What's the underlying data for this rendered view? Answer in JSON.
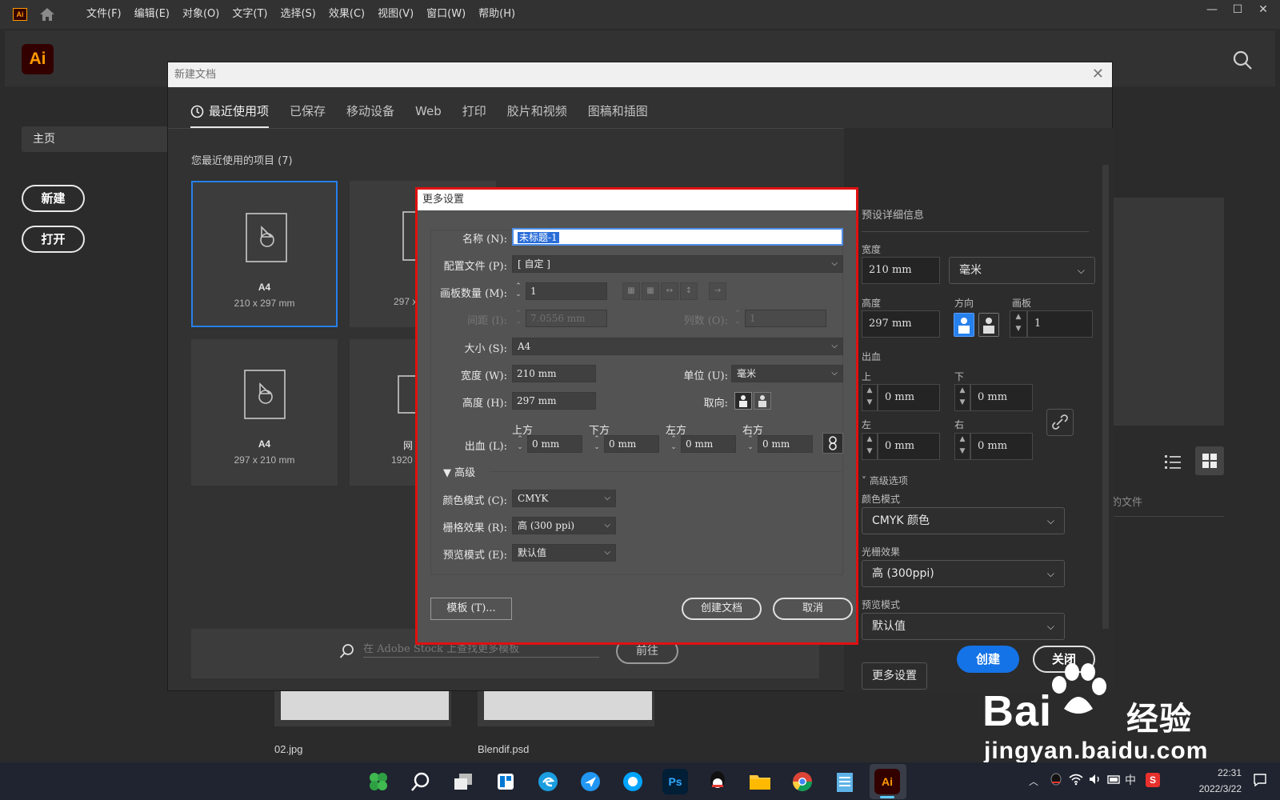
{
  "menu": [
    "文件(F)",
    "编辑(E)",
    "对象(O)",
    "文字(T)",
    "选择(S)",
    "效果(C)",
    "视图(V)",
    "窗口(W)",
    "帮助(H)"
  ],
  "app": {
    "logo_text": "Ai",
    "mini_logo_text": "Ai"
  },
  "window_controls": {
    "minimize": "—",
    "maximize": "☐",
    "close": "✕"
  },
  "sidebar": {
    "home": "主页",
    "new_button": "新建",
    "open_button": "打开"
  },
  "background": {
    "files": [
      {
        "name": "02.jpg"
      },
      {
        "name": "Blendif.psd"
      }
    ],
    "partial_label": "的文件"
  },
  "new_document": {
    "title": "新建文档",
    "tabs": [
      "最近使用项",
      "已保存",
      "移动设备",
      "Web",
      "打印",
      "胶片和视频",
      "图稿和插图"
    ],
    "recent_label": "您最近使用的项目 (7)",
    "cards": [
      {
        "name": "A4",
        "size": "210 x 297 mm"
      },
      {
        "name": "",
        "size": "297 x"
      },
      {
        "name": "A4",
        "size": "297 x 210 mm"
      },
      {
        "name": "网",
        "size": "1920"
      }
    ],
    "stock": {
      "placeholder": "在 Adobe Stock 上查找更多模板",
      "go": "前往"
    },
    "preset": {
      "title": "预设详细信息",
      "width_label": "宽度",
      "width_value": "210 mm",
      "unit": "毫米",
      "height_label": "高度",
      "height_value": "297 mm",
      "orientation_label": "方向",
      "artboard_label": "画板",
      "artboard_value": "1",
      "bleed_label": "出血",
      "top_label": "上",
      "bottom_label": "下",
      "left_label": "左",
      "right_label": "右",
      "bleed_top": "0 mm",
      "bleed_bottom": "0 mm",
      "bleed_left": "0 mm",
      "bleed_right": "0 mm",
      "advanced_label": "高级选项",
      "color_mode_label": "颜色模式",
      "color_mode": "CMYK 颜色",
      "raster_label": "光栅效果",
      "raster": "高 (300ppi)",
      "preview_label": "预览模式",
      "preview": "默认值",
      "more_settings": "更多设置"
    },
    "create": "创建",
    "close": "关闭"
  },
  "more_settings": {
    "title": "更多设置",
    "name_label": "名称 (N):",
    "name_value": "未标题-1",
    "profile_label": "配置文件 (P):",
    "profile_value": "[ 自定 ]",
    "artboards_label": "画板数量 (M):",
    "artboards_value": "1",
    "spacing_label": "间距 (I):",
    "spacing_value": "7.0556 mm",
    "columns_label": "列数 (O):",
    "columns_value": "1",
    "size_label": "大小 (S):",
    "size_value": "A4",
    "width_label": "宽度 (W):",
    "width_value": "210 mm",
    "units_label": "单位 (U):",
    "units_value": "毫米",
    "height_label": "高度 (H):",
    "height_value": "297 mm",
    "orientation_label": "取向:",
    "bleed_label": "出血 (L):",
    "bleed_top_label": "上方",
    "bleed_bottom_label": "下方",
    "bleed_left_label": "左方",
    "bleed_right_label": "右方",
    "bleed_top": "0 mm",
    "bleed_bottom": "0 mm",
    "bleed_left": "0 mm",
    "bleed_right": "0 mm",
    "advanced_label": "高级",
    "color_mode_label": "颜色模式 (C):",
    "color_mode": "CMYK",
    "raster_label": "栅格效果 (R):",
    "raster": "高 (300 ppi)",
    "preview_label": "预览模式 (E):",
    "preview": "默认值",
    "templates_button": "模板 (T)...",
    "create_button": "创建文档",
    "cancel_button": "取消"
  },
  "taskbar": {
    "time": "22:31",
    "date": "2022/3/22",
    "ime": "中",
    "apps": [
      "start",
      "search",
      "task-view",
      "widgets",
      "edge",
      "feishu",
      "browser",
      "photoshop",
      "qq",
      "file-explorer",
      "chrome",
      "notepad",
      "illustrator"
    ]
  },
  "watermark": {
    "brand": "Bai",
    "brand2": "经验",
    "url": "jingyan.baidu.com"
  },
  "colors": {
    "accent": "#1473e6",
    "highlight": "#e01010",
    "ai_orange": "#ff9a00"
  }
}
